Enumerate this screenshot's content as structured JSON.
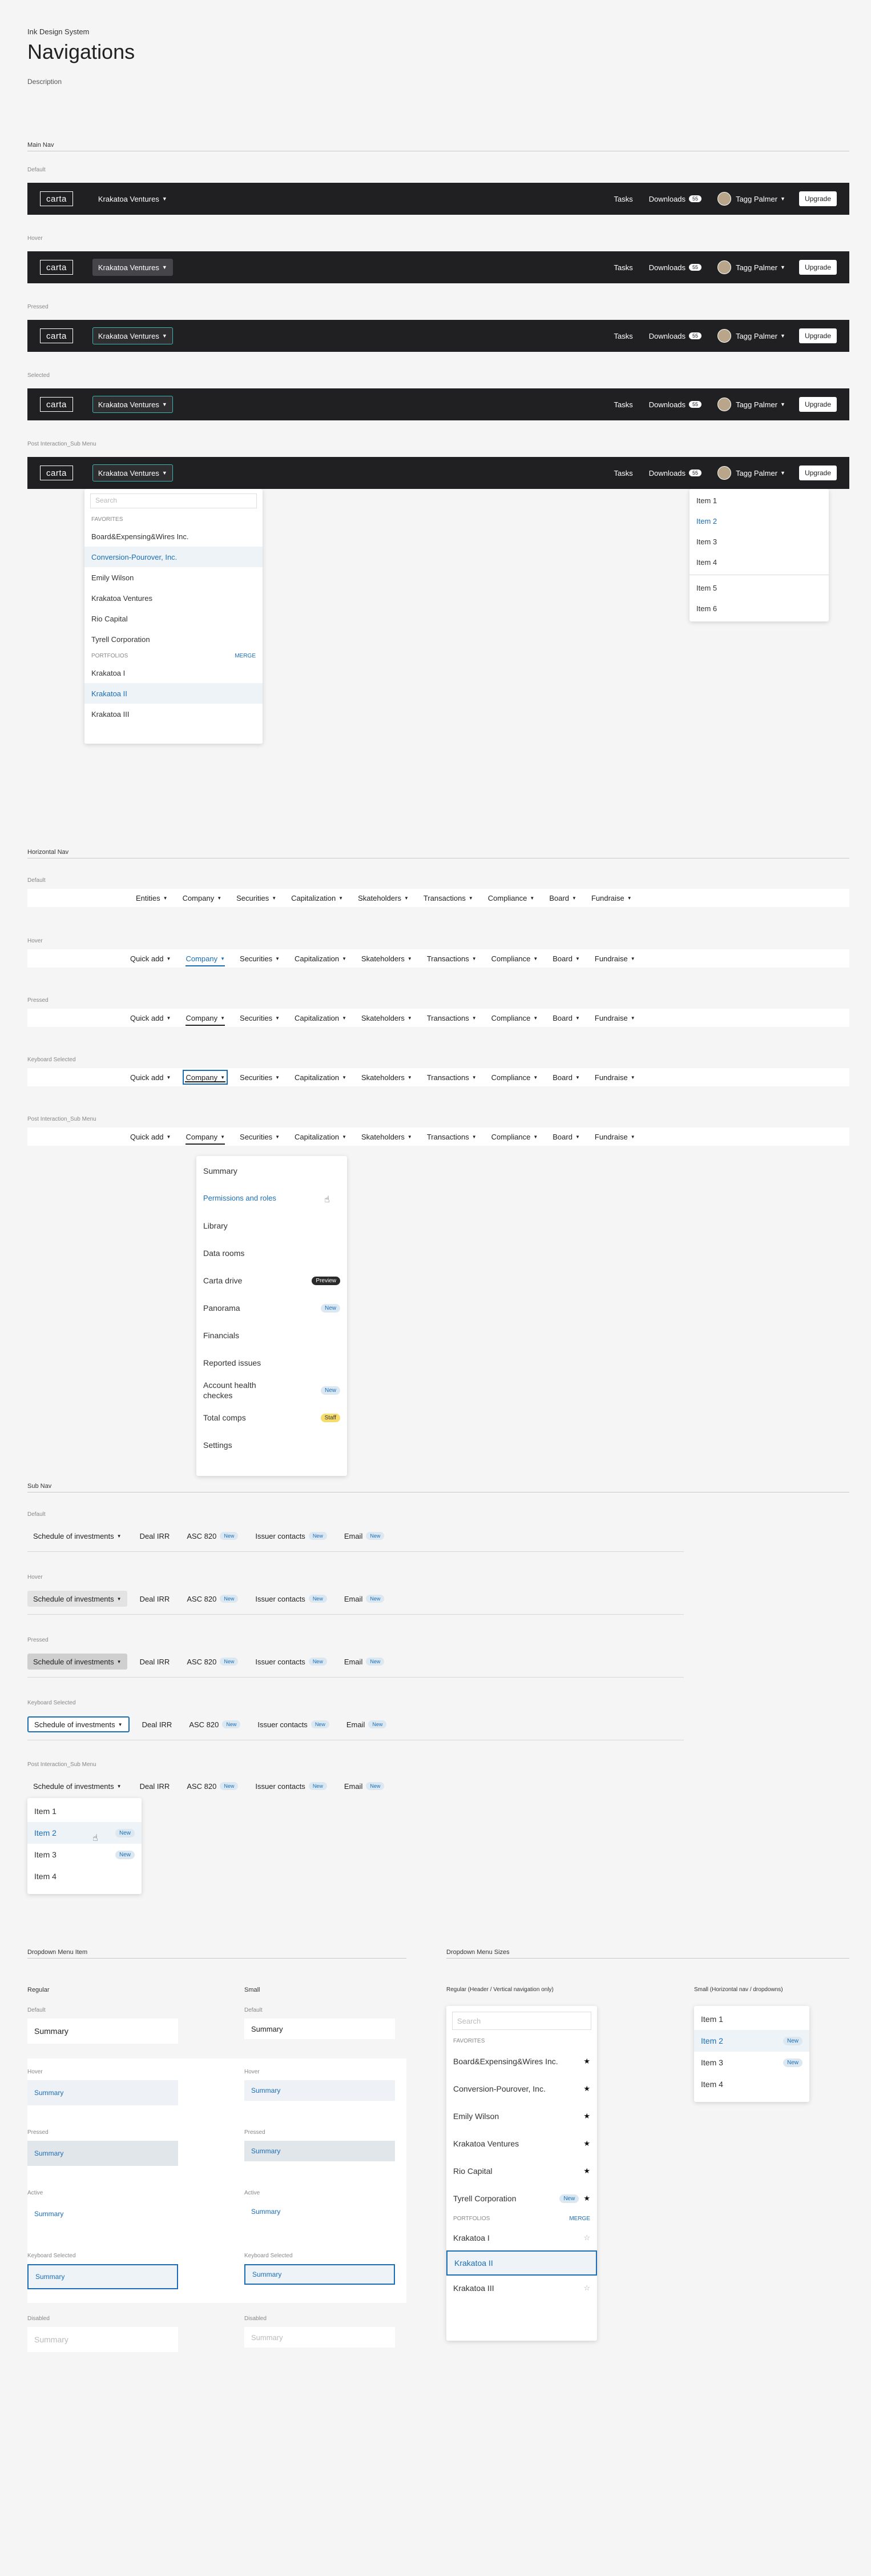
{
  "header": {
    "supertitle": "Ink Design System",
    "title": "Navigations",
    "description": "Description"
  },
  "main_nav": {
    "section": "Main Nav",
    "logo": "carta",
    "fund": "Krakatoa Ventures",
    "tasks": "Tasks",
    "downloads": "Downloads",
    "downloads_count": "55",
    "user": "Tagg Palmer",
    "upgrade": "Upgrade",
    "states": [
      "Default",
      "Hover",
      "Pressed",
      "Selected",
      "Post Interaction_Sub Menu"
    ],
    "fund_menu": {
      "search_placeholder": "Search",
      "favorites": "FAVORITES",
      "favorites_items": [
        "Board&Expensing&Wires Inc.",
        "Conversion-Pourover, Inc.",
        "Emily Wilson",
        "Krakatoa Ventures",
        "Rio Capital",
        "Tyrell Corporation"
      ],
      "portfolios": "PORTFOLIOS",
      "merge": "MERGE",
      "portfolio_items": [
        "Krakatoa I",
        "Krakatoa II",
        "Krakatoa III"
      ]
    },
    "user_menu": {
      "items": [
        "Item 1",
        "Item 2",
        "Item 3",
        "Item 4",
        "Item 5",
        "Item 6"
      ]
    }
  },
  "horizontal_nav": {
    "section": "Horizontal Nav",
    "default_items": [
      "Entities",
      "Company",
      "Securities",
      "Capitalization",
      "Skateholders",
      "Transactions",
      "Compliance",
      "Board",
      "Fundraise"
    ],
    "items": [
      "Quick add",
      "Company",
      "Securities",
      "Capitalization",
      "Skateholders",
      "Transactions",
      "Compliance",
      "Board",
      "Fundraise"
    ],
    "states": [
      "Default",
      "Hover",
      "Pressed",
      "Keyboard Selected",
      "Post Interaction_Sub Menu"
    ],
    "company_menu": [
      {
        "label": "Summary",
        "badge": ""
      },
      {
        "label": "Permissions and roles",
        "badge": ""
      },
      {
        "label": "Library",
        "badge": ""
      },
      {
        "label": "Data rooms",
        "badge": ""
      },
      {
        "label": "Carta drive",
        "badge": "Preview"
      },
      {
        "label": "Panorama",
        "badge": "New"
      },
      {
        "label": "Financials",
        "badge": ""
      },
      {
        "label": "Reported issues",
        "badge": ""
      },
      {
        "label": "Account health checkes",
        "badge": "New"
      },
      {
        "label": "Total comps",
        "badge": "Staff"
      },
      {
        "label": "Settings",
        "badge": ""
      }
    ]
  },
  "sub_nav": {
    "section": "Sub Nav",
    "states": [
      "Default",
      "Hover",
      "Pressed",
      "Keyboard Selected",
      "Post Interaction_Sub Menu"
    ],
    "items": {
      "first": "Schedule of investments",
      "deal": "Deal IRR",
      "asc": "ASC 820",
      "issuer": "Issuer contacts",
      "email": "Email",
      "new": "New"
    },
    "menu": [
      {
        "label": "Item 1",
        "badge": ""
      },
      {
        "label": "Item 2",
        "badge": "New"
      },
      {
        "label": "Item 3",
        "badge": "New"
      },
      {
        "label": "Item 4",
        "badge": ""
      }
    ]
  },
  "dropdown_menu_item": {
    "section": "Dropdown Menu Item",
    "regular": "Regular",
    "small": "Small",
    "states": [
      "Default",
      "Hover",
      "Pressed",
      "Active",
      "Keyboard Selected",
      "Disabled"
    ],
    "value": "Summary"
  },
  "dropdown_sizes": {
    "section": "Dropdown Menu Sizes",
    "regular_label": "Regular (Header / Vertical navigation only)",
    "small_label": "Small (Horizontal nav / dropdowns)",
    "search_placeholder": "Search",
    "favorites": "FAVORITES",
    "favorites_items": [
      "Board&Expensing&Wires Inc.",
      "Conversion-Pourover, Inc.",
      "Emily Wilson",
      "Krakatoa Ventures",
      "Rio Capital",
      "Tyrell Corporation"
    ],
    "new": "New",
    "portfolios": "PORTFOLIOS",
    "merge": "MERGE",
    "portfolio_items": [
      "Krakatoa I",
      "Krakatoa II",
      "Krakatoa III"
    ],
    "small_items": [
      {
        "label": "Item 1",
        "badge": ""
      },
      {
        "label": "Item 2",
        "badge": "New"
      },
      {
        "label": "Item 3",
        "badge": "New"
      },
      {
        "label": "Item 4",
        "badge": ""
      }
    ]
  }
}
